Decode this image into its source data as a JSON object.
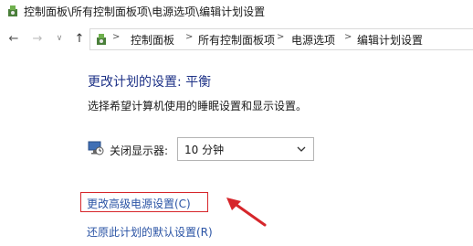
{
  "window": {
    "title": "控制面板\\所有控制面板项\\电源选项\\编辑计划设置"
  },
  "nav": {
    "back_icon": "back-arrow-icon",
    "forward_icon": "forward-arrow-icon",
    "history_icon": "chevron-down-icon",
    "up_icon": "up-arrow-icon",
    "breadcrumb": [
      "控制面板",
      "所有控制面板项",
      "电源选项",
      "编辑计划设置"
    ],
    "separator": ">"
  },
  "main": {
    "title": "更改计划的设置: 平衡",
    "description": "选择希望计算机使用的睡眠设置和显示设置。",
    "display_off": {
      "label": "关闭显示器:",
      "value": "10 分钟",
      "icon": "monitor-clock-icon"
    },
    "links": {
      "advanced": "更改高级电源设置(C)",
      "restore": "还原此计划的默认设置(R)"
    }
  },
  "colors": {
    "title_blue": "#1e3287",
    "link_blue": "#2b54a5",
    "annotation_red": "#d6262b"
  }
}
